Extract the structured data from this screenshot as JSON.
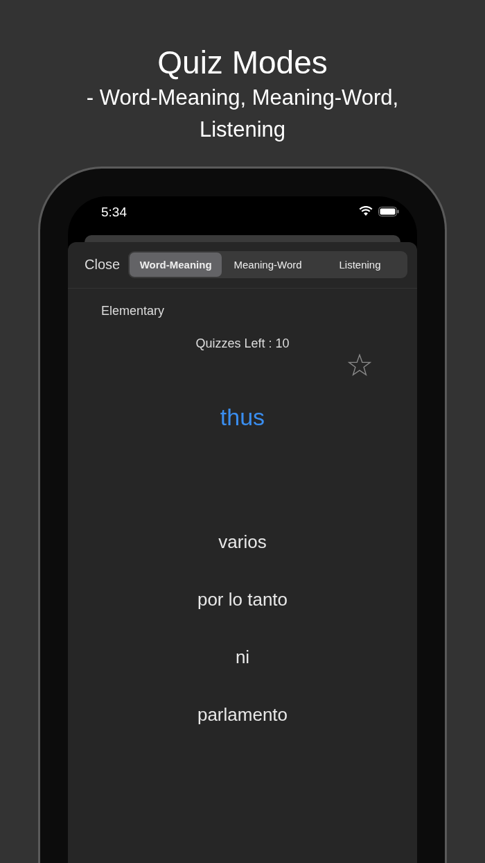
{
  "header": {
    "title": "Quiz Modes",
    "subtitle": "- Word-Meaning, Meaning-Word, Listening"
  },
  "status_bar": {
    "time": "5:34"
  },
  "toolbar": {
    "close": "Close",
    "tabs": [
      {
        "label": "Word-Meaning",
        "selected": true
      },
      {
        "label": "Meaning-Word",
        "selected": false
      },
      {
        "label": "Listening",
        "selected": false
      }
    ]
  },
  "quiz": {
    "level": "Elementary",
    "remaining": "Quizzes Left : 10",
    "starred": false,
    "word": "thus",
    "options": [
      "varios",
      "por lo tanto",
      "ni",
      "parlamento"
    ]
  }
}
